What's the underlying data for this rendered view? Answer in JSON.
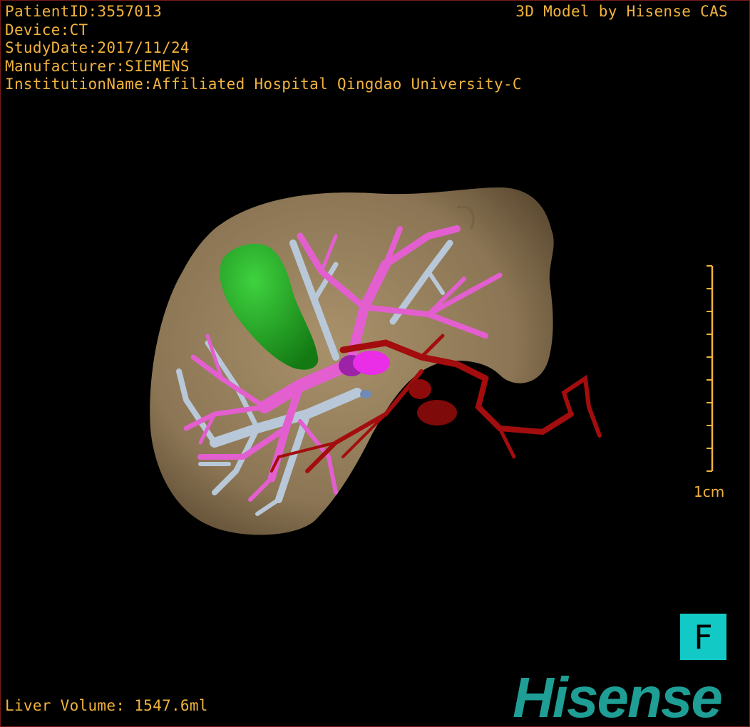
{
  "patient_info": {
    "patient_id": "PatientID:3557013",
    "device": "Device:CT",
    "study_date": "StudyDate:2017/11/24",
    "manufacturer": "Manufacturer:SIEMENS",
    "institution": "InstitutionName:Affiliated Hospital Qingdao University-C"
  },
  "model_credit": "3D Model by Hisense CAS",
  "scale_bar": {
    "label": "1cm"
  },
  "orientation_marker": {
    "label": "F"
  },
  "liver_volume": "Liver Volume: 1547.6ml",
  "logo": {
    "text": "Hisense",
    "color": "#1e9e94"
  },
  "colors": {
    "overlay_text": "#f2b33d",
    "liver": "#8b7554",
    "tumor": "#1f9e1f",
    "portal_vein": "#e35fcf",
    "hepatic_vein": "#b9c8d8",
    "artery": "#a30d0d",
    "orientation_bg": "#13c9c6"
  }
}
